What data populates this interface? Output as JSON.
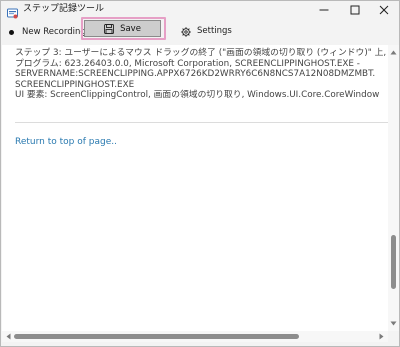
{
  "window": {
    "title": "ステップ記録ツール",
    "controls": {
      "minimize": "minimize-icon",
      "maximize": "maximize-icon",
      "close": "close-icon"
    }
  },
  "toolbar": {
    "new_recording_label": "New Recording",
    "save_label": "Save",
    "settings_label": "Settings"
  },
  "step": {
    "lines": [
      "ステップ 3: ユーザーによるマウス ドラッグの終了 (\"画面の領域の切り取り (ウィンドウ)\" 上, \"画面の",
      "プログラム: 623.26403.0.0, Microsoft Corporation, SCREENCLIPPINGHOST.EXE -",
      "SERVERNAME:SCREENCLIPPING.APPX6726KD2WRRY6C6N8NCS7A12N08DMZMBT.",
      "SCREENCLIPPINGHOST.EXE",
      "UI 要素: ScreenClippingControl, 画面の領域の切り取り, Windows.UI.Core.CoreWindow"
    ]
  },
  "links": {
    "return_to_top": "Return to top of page.."
  },
  "colors": {
    "link": "#2a7ab0",
    "save_highlight": "#e6a0c6",
    "save_button_bg": "#cdcdcd"
  }
}
